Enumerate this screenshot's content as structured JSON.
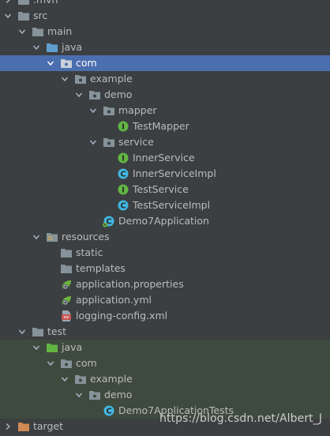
{
  "tree": {
    "items": [
      {
        "label": ".mvn"
      },
      {
        "label": "src"
      },
      {
        "label": "main"
      },
      {
        "label": "java"
      },
      {
        "label": "com"
      },
      {
        "label": "example"
      },
      {
        "label": "demo"
      },
      {
        "label": "mapper"
      },
      {
        "label": "TestMapper"
      },
      {
        "label": "service"
      },
      {
        "label": "InnerService"
      },
      {
        "label": "InnerServiceImpl"
      },
      {
        "label": "TestService"
      },
      {
        "label": "TestServiceImpl"
      },
      {
        "label": "Demo7Application"
      },
      {
        "label": "resources"
      },
      {
        "label": "static"
      },
      {
        "label": "templates"
      },
      {
        "label": "application.properties"
      },
      {
        "label": "application.yml"
      },
      {
        "label": "logging-config.xml"
      },
      {
        "label": "test"
      },
      {
        "label": "java"
      },
      {
        "label": "com"
      },
      {
        "label": "example"
      },
      {
        "label": "demo"
      },
      {
        "label": "Demo7ApplicationTests"
      },
      {
        "label": "target"
      }
    ]
  },
  "watermark": "https://blog.csdn.net/Albert_J",
  "colors": {
    "background": "#3c3f41",
    "selection": "#4b6eaf",
    "test_tint": "#3f4a3e",
    "folder": "#87939a",
    "source_folder": "#5f9fcf",
    "test_folder": "#62b543",
    "interface_icon": "#62b543",
    "class_icon": "#40b6e0"
  }
}
